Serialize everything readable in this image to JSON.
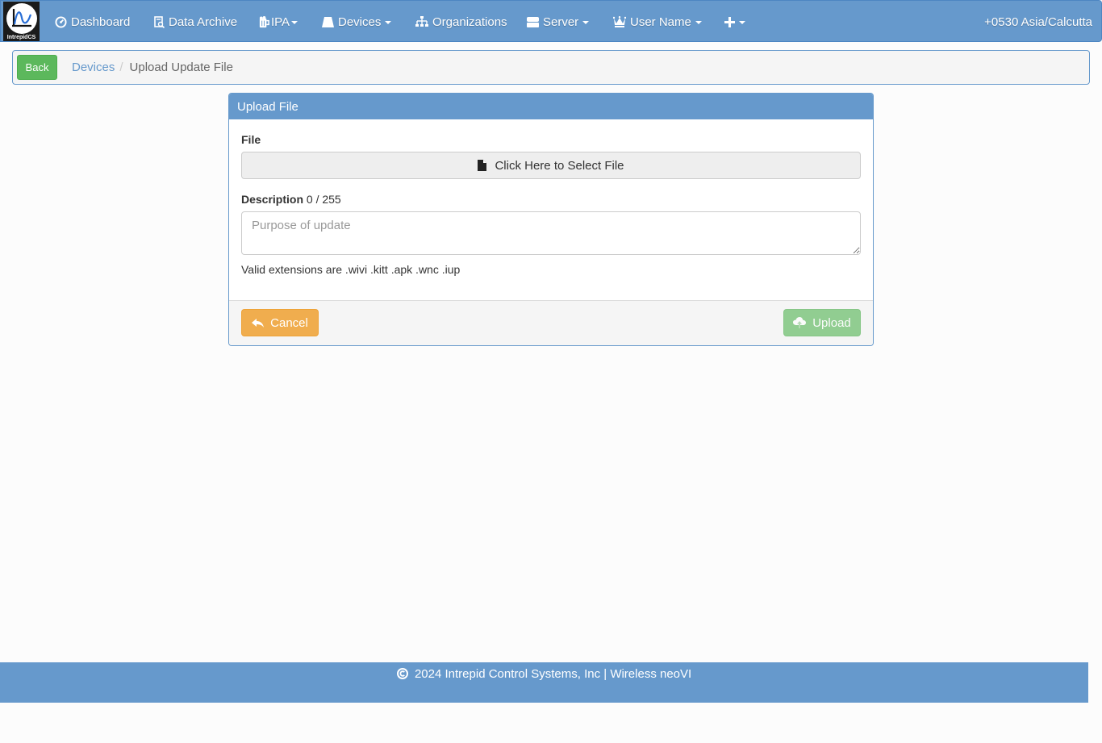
{
  "brand": {
    "name": "IntrepidCS",
    "icon": "intrepidcs-logo"
  },
  "navbar": {
    "items": [
      {
        "label": "Dashboard",
        "icon": "dashboard-icon",
        "dropdown": false
      },
      {
        "label": "Data Archive",
        "icon": "data-archive-icon",
        "dropdown": false
      },
      {
        "label": "IPA",
        "icon": "beer-mug-icon",
        "dropdown": true
      },
      {
        "label": "Devices",
        "icon": "device-icon",
        "dropdown": true
      },
      {
        "label": "Organizations",
        "icon": "sitemap-icon",
        "dropdown": false
      },
      {
        "label": "Server",
        "icon": "server-icon",
        "dropdown": true
      },
      {
        "label": "User Name",
        "icon": "crown-icon",
        "dropdown": true
      },
      {
        "label": "",
        "icon": "plus-icon",
        "dropdown": true
      }
    ],
    "timezone": "+0530 Asia/Calcutta"
  },
  "breadcrumb": {
    "back_label": "Back",
    "items": [
      {
        "label": "Devices",
        "link": true
      },
      {
        "label": "Upload Update File",
        "link": false
      }
    ],
    "separator": "/"
  },
  "panel": {
    "title": "Upload File",
    "file_label": "File",
    "file_button_label": "Click Here to Select File",
    "file_button_icon": "file-icon",
    "description_label": "Description",
    "description_count": "0 / 255",
    "description_value": "",
    "description_placeholder": "Purpose of update",
    "extensions_note": "Valid extensions are .wivi .kitt .apk .wnc .iup",
    "cancel_label": "Cancel",
    "cancel_icon": "reply-icon",
    "upload_label": "Upload",
    "upload_icon": "cloud-upload-icon",
    "upload_disabled": true
  },
  "footer": {
    "text": "2024 Intrepid Control Systems, Inc | Wireless neoVI",
    "icon": "copyright-icon"
  },
  "colors": {
    "primary": "#6699cc",
    "success": "#5cb85c",
    "warning": "#f0ad4e",
    "background": "#fcfcfc"
  }
}
